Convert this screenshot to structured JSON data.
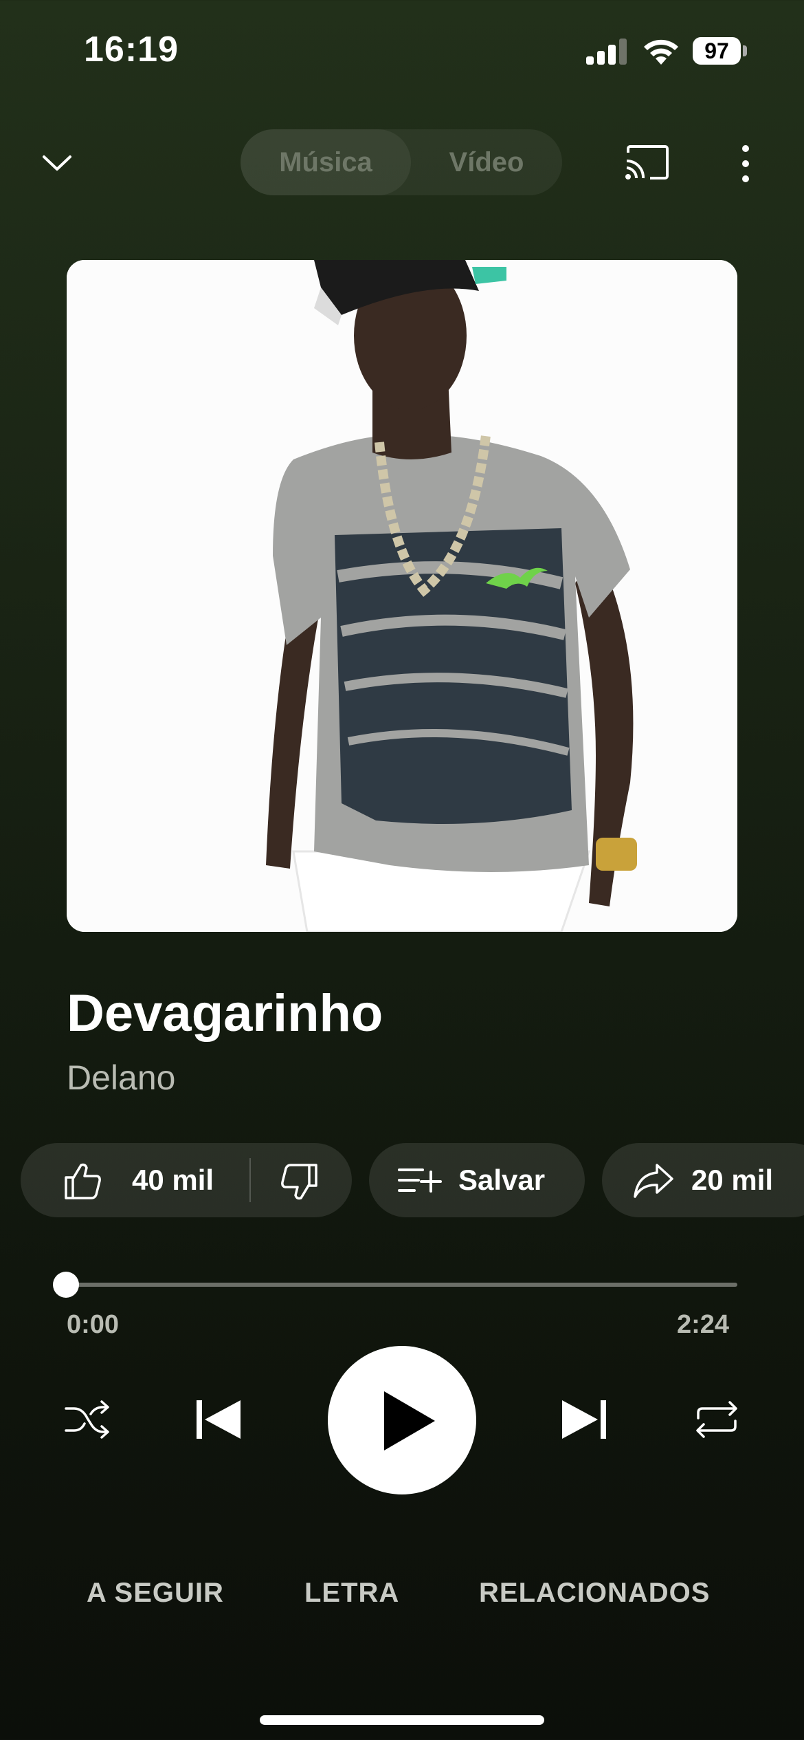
{
  "status_bar": {
    "time": "16:19",
    "battery": "97"
  },
  "header": {
    "tab_music": "Música",
    "tab_video": "Vídeo"
  },
  "track": {
    "title": "Devagarinho",
    "artist": "Delano"
  },
  "actions": {
    "likes": "40 mil",
    "save": "Salvar",
    "shares": "20 mil"
  },
  "progress": {
    "current": "0:00",
    "total": "2:24",
    "fraction": 0
  },
  "tabs": {
    "up_next": "A SEGUIR",
    "lyrics": "LETRA",
    "related": "RELACIONADOS"
  },
  "icons": {
    "collapse": "chevron-down-icon",
    "cast": "cast-icon",
    "more": "more-vertical-icon",
    "like": "thumbs-up-icon",
    "dislike": "thumbs-down-icon",
    "save": "playlist-add-icon",
    "share": "share-icon",
    "shuffle": "shuffle-icon",
    "previous": "skip-previous-icon",
    "play": "play-icon",
    "next": "skip-next-icon",
    "repeat": "repeat-icon"
  }
}
